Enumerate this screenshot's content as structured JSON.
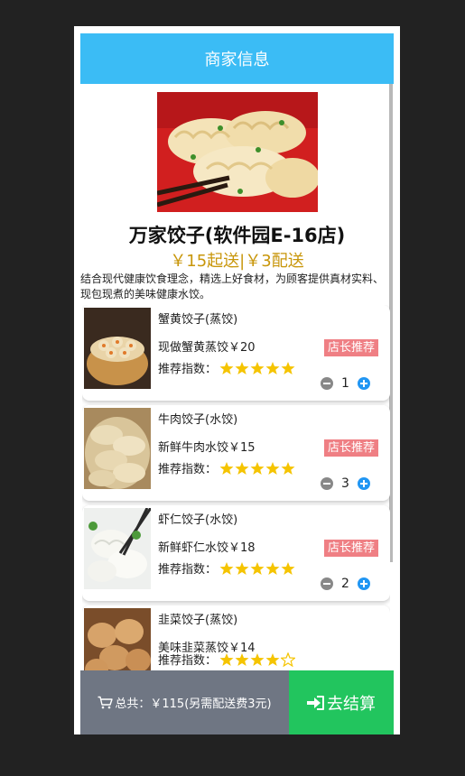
{
  "header": {
    "title": "商家信息"
  },
  "shop": {
    "name": "万家饺子(软件园E-16店)",
    "fee": "￥15起送|￥3配送",
    "description": "结合现代健康饮食理念，精选上好食材，为顾客提供真材实料、现包现煮的美味健康水饺。"
  },
  "items": [
    {
      "title": "蟹黄饺子(蒸饺)",
      "desc": "现做蟹黄蒸饺￥20",
      "badge": "店长推荐",
      "rating_label": "推荐指数：",
      "rating": 5,
      "quantity": "1"
    },
    {
      "title": "牛肉饺子(水饺)",
      "desc": "新鲜牛肉水饺￥15",
      "badge": "店长推荐",
      "rating_label": "推荐指数：",
      "rating": 5,
      "quantity": "3"
    },
    {
      "title": "虾仁饺子(水饺)",
      "desc": "新鲜虾仁水饺￥18",
      "badge": "店长推荐",
      "rating_label": "推荐指数：",
      "rating": 5,
      "quantity": "2"
    },
    {
      "title": "韭菜饺子(蒸饺)",
      "desc": "美味韭菜蒸饺￥14",
      "badge": "",
      "rating_label": "推荐指数：",
      "rating": 4,
      "quantity": ""
    }
  ],
  "footer": {
    "total": "总共：￥115(另需配送费3元)",
    "checkout": "去结算"
  },
  "colors": {
    "header": "#3bbcf5",
    "badge": "#ef7f84",
    "checkout": "#22c55e",
    "total_bar": "#6f7683",
    "star": "#f5c400",
    "plus": "#2196f3"
  },
  "icons": {
    "cart": "cart-icon",
    "checkout": "sign-in-icon",
    "minus": "minus-circle-icon",
    "plus": "plus-circle-icon",
    "star": "star-icon"
  }
}
